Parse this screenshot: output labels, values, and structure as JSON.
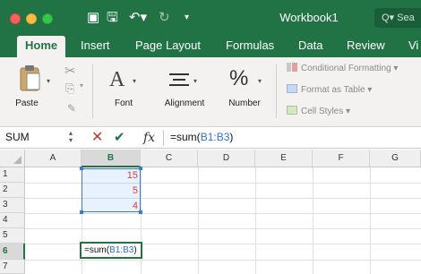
{
  "window": {
    "title": "Workbook1",
    "search_placeholder": "Q▾ Sea"
  },
  "tabs": [
    "Home",
    "Insert",
    "Page Layout",
    "Formulas",
    "Data",
    "Review",
    "Vi"
  ],
  "ribbon": {
    "paste_label": "Paste",
    "font_label": "Font",
    "font_glyph": "A",
    "alignment_label": "Alignment",
    "number_label": "Number",
    "number_glyph": "%",
    "conditional_formatting": "Conditional Formatting",
    "format_as_table": "Format as Table",
    "cell_styles": "Cell Styles"
  },
  "formula_bar": {
    "name_box": "SUM",
    "fx": "fx",
    "formula_prefix": "=sum(",
    "formula_ref": "B1:B3",
    "formula_suffix": ")"
  },
  "sheet": {
    "columns": [
      "A",
      "B",
      "C",
      "D",
      "E",
      "F",
      "G"
    ],
    "rows": [
      "1",
      "2",
      "3",
      "4",
      "5",
      "6",
      "7"
    ],
    "b1": "15",
    "b2": "5",
    "b3": "4",
    "b6_prefix": "=sum(",
    "b6_ref": "B1:B3",
    "b6_suffix": ")"
  },
  "colors": {
    "accent": "#217346",
    "reference_blue": "#3b78d8",
    "value_red": "#e23b3b"
  }
}
